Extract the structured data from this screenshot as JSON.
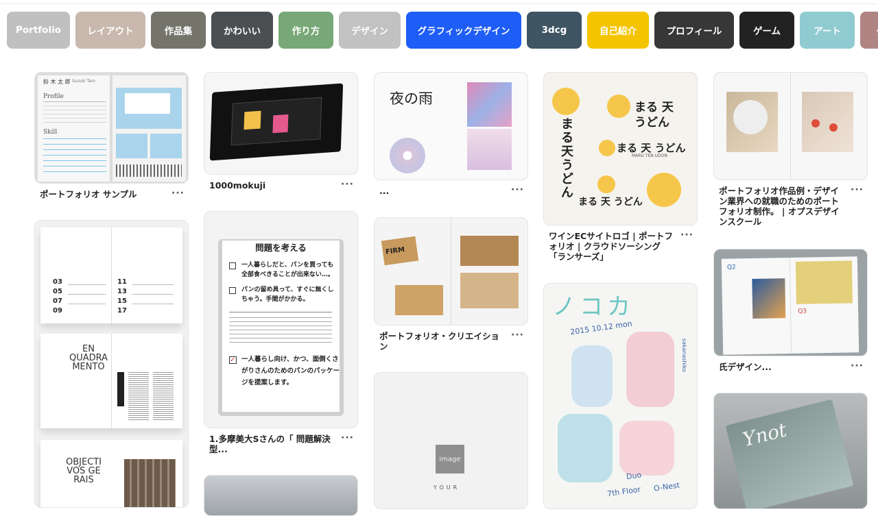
{
  "categories": [
    {
      "label": "Portfolio",
      "color": "#c0c0c0",
      "w": 92
    },
    {
      "label": "レイアウト",
      "color": "#c9b8ad",
      "w": 102
    },
    {
      "label": "作品集",
      "color": "#74746b",
      "w": 80
    },
    {
      "label": "かわいい",
      "color": "#4b4f52",
      "w": 90
    },
    {
      "label": "作り方",
      "color": "#78a877",
      "w": 80
    },
    {
      "label": "デザイン",
      "color": "#c2c2c2",
      "w": 90
    },
    {
      "label": "グラフィックデザイン",
      "color": "#1f5ef6",
      "w": 168
    },
    {
      "label": "3dcg",
      "color": "#405564",
      "w": 80
    },
    {
      "label": "自己紹介",
      "color": "#f4c400",
      "w": 90
    },
    {
      "label": "プロフィール",
      "color": "#373737",
      "w": 116
    },
    {
      "label": "ゲーム",
      "color": "#222222",
      "w": 80
    },
    {
      "label": "アート",
      "color": "#8fcbd1",
      "w": 80
    },
    {
      "label": "グ",
      "color": "#b08483",
      "w": 60
    }
  ],
  "more_label": "···",
  "pins": {
    "p1": {
      "caption": "ポートフォリオ サンプル",
      "name_title": "鈴 木 太 郎",
      "name_en": "Suzuki Taro",
      "profile": "Profile",
      "skill": "Skill"
    },
    "p2": {
      "index": [
        "03",
        "05",
        "07",
        "09",
        "11",
        "13",
        "15",
        "17"
      ],
      "title1": "EN QUADRA MENTO",
      "title2": "OBJECTI VOS GE RAIS"
    },
    "p3": {
      "caption": "1000mokuji"
    },
    "p4": {
      "caption": "1.多摩美大Sさんの「 問題解決型...",
      "heading": "問題を考える",
      "item1": "一人暮らしだと、パンを買っても全部食べきることが出来ない…。",
      "item2": "パンの留め具って、すぐに無くしちゃう。手間がかかる。",
      "item3": "一人暮らし向け、かつ、面倒くさがりさんのためのパンのパッケージを提案します。"
    },
    "p5": {
      "caption": "...",
      "title": "夜の雨"
    },
    "p6": {
      "caption": "ポートフォリオ・クリエイション",
      "tag": "FIRM"
    },
    "p7": {
      "img_label": "image",
      "your": "YOUR"
    },
    "p8": {
      "caption": "ワインECサイトロゴ | ポートフォリオ | クラウドソーシング「ランサーズ」",
      "logo_v": "まる天うどん",
      "logo_a": "まる 天",
      "logo_b": "うどん",
      "logo_c": "まる 天 うどん",
      "sub": "MARU TEN UDON"
    },
    "p9": {
      "date": "2015 10.12 mon",
      "band": "ノコカ",
      "place": "7th Floor",
      "duo": "Duo",
      "onest": "O-Nest",
      "side": "sakanashiko"
    },
    "p10": {
      "caption": "ポートフォリオ作品例・デザイン業界への就職のためのポートフォリオ制作。 | オプスデザインスクール"
    },
    "p11": {
      "caption": "氏デザイン...",
      "q2": "Q2",
      "q3": "Q3"
    },
    "p12": {
      "title": "Ynot"
    }
  }
}
